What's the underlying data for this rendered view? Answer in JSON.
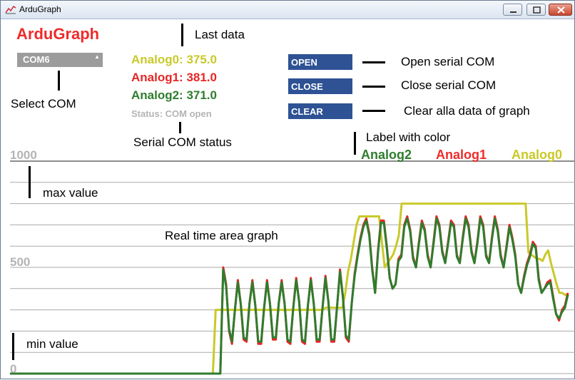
{
  "window": {
    "title": "ArduGraph"
  },
  "header": {
    "title": "ArduGraph"
  },
  "com_select": {
    "value": "COM6"
  },
  "readings": [
    {
      "label": "Analog0: 375.0",
      "color": "#c9c92a"
    },
    {
      "label": "Analog1: 381.0",
      "color": "#e52626"
    },
    {
      "label": "Analog2: 371.0",
      "color": "#2e7d2e"
    }
  ],
  "status": "Status: COM open",
  "buttons": {
    "open": "OPEN",
    "close": "CLOSE",
    "clear": "CLEAR"
  },
  "annotations": {
    "last_data": "Last data",
    "select_com": "Select COM",
    "serial_status": "Serial COM status",
    "open_desc": "Open serial COM",
    "close_desc": "Close serial COM",
    "clear_desc": "Clear alla data of graph",
    "label_color": "Label with color",
    "max_value": "max value",
    "min_value": "min value",
    "area_graph": "Real time area graph"
  },
  "legend": [
    {
      "name": "Analog2",
      "color": "#2e7d2e"
    },
    {
      "name": "Analog1",
      "color": "#ee2b2b"
    },
    {
      "name": "Analog0",
      "color": "#c9c92a"
    }
  ],
  "chart_data": {
    "type": "line",
    "ylim": [
      0,
      1000
    ],
    "tick_labels": [
      "1000",
      "500",
      "0"
    ],
    "grid": true,
    "legend_placement": "top-right",
    "series": [
      {
        "name": "Analog0",
        "color": "#c9c92a",
        "values": [
          0,
          0,
          0,
          0,
          0,
          0,
          0,
          0,
          0,
          0,
          0,
          0,
          0,
          0,
          0,
          0,
          0,
          0,
          0,
          0,
          0,
          0,
          0,
          0,
          0,
          0,
          0,
          0,
          0,
          0,
          0,
          0,
          0,
          0,
          0,
          0,
          0,
          0,
          0,
          0,
          0,
          0,
          0,
          0,
          0,
          0,
          0,
          0,
          0,
          0,
          0,
          0,
          0,
          0,
          0,
          0,
          0,
          0,
          0,
          0,
          0,
          0,
          0,
          0,
          0,
          0,
          0,
          0,
          0,
          0,
          0,
          0,
          0,
          300,
          300,
          300,
          300,
          300,
          300,
          300,
          300,
          300,
          300,
          300,
          300,
          300,
          300,
          300,
          300,
          300,
          300,
          300,
          300,
          300,
          300,
          300,
          300,
          300,
          300,
          300,
          300,
          300,
          300,
          300,
          300,
          300,
          300,
          300,
          300,
          300,
          300,
          300,
          310,
          310,
          310,
          310,
          310,
          310,
          310,
          380,
          480,
          540,
          620,
          700,
          740,
          740,
          740,
          740,
          740,
          740,
          740,
          740,
          620,
          500,
          520,
          540,
          560,
          600,
          650,
          800,
          800,
          800,
          800,
          800,
          800,
          800,
          800,
          800,
          800,
          800,
          800,
          800,
          800,
          800,
          800,
          800,
          800,
          800,
          800,
          800,
          800,
          800,
          800,
          800,
          800,
          800,
          800,
          800,
          800,
          800,
          800,
          800,
          800,
          800,
          800,
          800,
          800,
          800,
          800,
          800,
          800,
          800,
          800,
          800,
          570,
          560,
          550,
          540,
          540,
          530,
          560,
          580,
          520,
          470,
          420,
          380,
          380,
          370,
          375
        ]
      },
      {
        "name": "Analog1",
        "color": "#e52626",
        "values": [
          0,
          0,
          0,
          0,
          0,
          0,
          0,
          0,
          0,
          0,
          0,
          0,
          0,
          0,
          0,
          0,
          0,
          0,
          0,
          0,
          0,
          0,
          0,
          0,
          0,
          0,
          0,
          0,
          0,
          0,
          0,
          0,
          0,
          0,
          0,
          0,
          0,
          0,
          0,
          0,
          0,
          0,
          0,
          0,
          0,
          0,
          0,
          0,
          0,
          0,
          0,
          0,
          0,
          0,
          0,
          0,
          0,
          0,
          0,
          0,
          0,
          0,
          0,
          0,
          0,
          0,
          0,
          0,
          0,
          0,
          0,
          0,
          0,
          500,
          420,
          200,
          140,
          300,
          440,
          330,
          160,
          150,
          330,
          440,
          320,
          140,
          140,
          310,
          440,
          330,
          160,
          160,
          330,
          440,
          330,
          150,
          140,
          310,
          450,
          340,
          150,
          140,
          320,
          450,
          330,
          150,
          150,
          310,
          460,
          340,
          150,
          150,
          320,
          490,
          360,
          170,
          150,
          330,
          470,
          560,
          640,
          700,
          730,
          660,
          500,
          380,
          580,
          720,
          720,
          600,
          450,
          400,
          420,
          540,
          560,
          700,
          740,
          680,
          550,
          500,
          620,
          720,
          680,
          560,
          500,
          620,
          740,
          700,
          580,
          520,
          620,
          720,
          700,
          560,
          520,
          640,
          740,
          700,
          580,
          520,
          620,
          740,
          700,
          560,
          520,
          640,
          740,
          680,
          560,
          500,
          600,
          700,
          640,
          560,
          420,
          380,
          460,
          520,
          560,
          620,
          600,
          450,
          380,
          400,
          430,
          440,
          360,
          280,
          250,
          300,
          320,
          380
        ]
      },
      {
        "name": "Analog2",
        "color": "#2e7d2e",
        "values": [
          0,
          0,
          0,
          0,
          0,
          0,
          0,
          0,
          0,
          0,
          0,
          0,
          0,
          0,
          0,
          0,
          0,
          0,
          0,
          0,
          0,
          0,
          0,
          0,
          0,
          0,
          0,
          0,
          0,
          0,
          0,
          0,
          0,
          0,
          0,
          0,
          0,
          0,
          0,
          0,
          0,
          0,
          0,
          0,
          0,
          0,
          0,
          0,
          0,
          0,
          0,
          0,
          0,
          0,
          0,
          0,
          0,
          0,
          0,
          0,
          0,
          0,
          0,
          0,
          0,
          0,
          0,
          0,
          0,
          0,
          0,
          0,
          0,
          490,
          410,
          210,
          150,
          300,
          430,
          330,
          170,
          160,
          330,
          430,
          320,
          150,
          150,
          310,
          430,
          330,
          170,
          170,
          330,
          430,
          330,
          160,
          150,
          310,
          440,
          340,
          160,
          150,
          320,
          440,
          330,
          160,
          160,
          310,
          450,
          340,
          160,
          160,
          320,
          480,
          360,
          180,
          160,
          330,
          460,
          550,
          630,
          690,
          720,
          650,
          490,
          380,
          570,
          710,
          710,
          590,
          450,
          400,
          420,
          530,
          550,
          690,
          730,
          670,
          540,
          500,
          610,
          710,
          670,
          550,
          500,
          610,
          730,
          690,
          570,
          520,
          610,
          710,
          690,
          550,
          520,
          630,
          730,
          690,
          570,
          520,
          610,
          730,
          690,
          550,
          520,
          630,
          730,
          670,
          550,
          500,
          590,
          690,
          630,
          550,
          420,
          380,
          450,
          510,
          550,
          610,
          590,
          440,
          380,
          400,
          420,
          430,
          350,
          280,
          260,
          290,
          310,
          371
        ]
      }
    ]
  }
}
